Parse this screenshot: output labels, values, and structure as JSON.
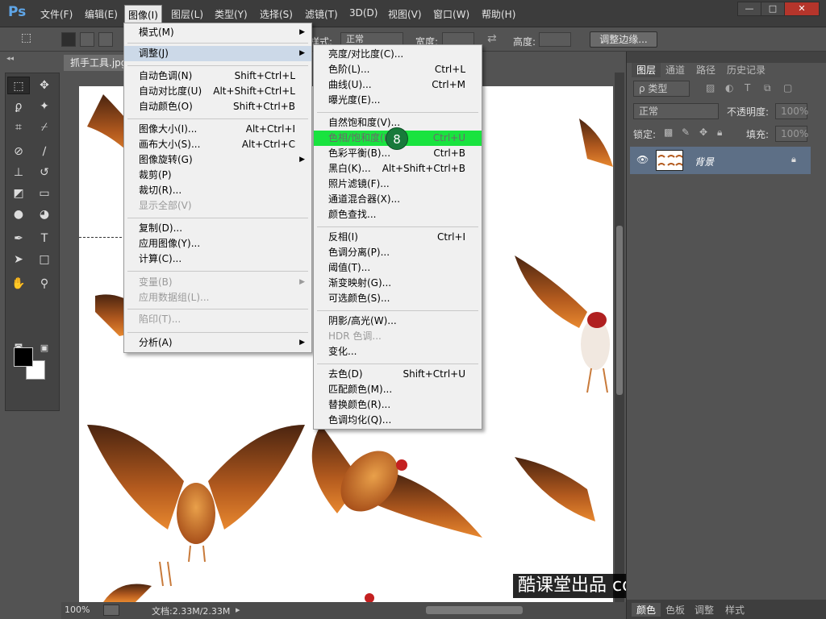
{
  "app": {
    "logo": "Ps"
  },
  "menubar": {
    "items": [
      "文件(F)",
      "编辑(E)",
      "图像(I)",
      "图层(L)",
      "类型(Y)",
      "选择(S)",
      "滤镜(T)",
      "3D(D)",
      "视图(V)",
      "窗口(W)",
      "帮助(H)"
    ],
    "active_index": 2
  },
  "window_buttons": {
    "minimize": "—",
    "maximize": "□",
    "close": "✕"
  },
  "options": {
    "style_label": "样式:",
    "style_value": "正常",
    "width_label": "宽度:",
    "height_label": "高度:",
    "refine_edge": "调整边缘..."
  },
  "document": {
    "tab_title": "抓手工具.jpg"
  },
  "status": {
    "zoom": "100%",
    "doc_info": "文档:2.33M/2.33M"
  },
  "watermark": "酷课堂出品 coolketang.com",
  "image_menu": {
    "items": [
      {
        "label": "模式(M)",
        "shortcut": "",
        "submenu": true
      },
      {
        "label": "调整(J)",
        "shortcut": "",
        "submenu": true,
        "highlight": true
      },
      {
        "label": "自动色调(N)",
        "shortcut": "Shift+Ctrl+L"
      },
      {
        "label": "自动对比度(U)",
        "shortcut": "Alt+Shift+Ctrl+L"
      },
      {
        "label": "自动颜色(O)",
        "shortcut": "Shift+Ctrl+B"
      },
      {
        "label": "图像大小(I)...",
        "shortcut": "Alt+Ctrl+I"
      },
      {
        "label": "画布大小(S)...",
        "shortcut": "Alt+Ctrl+C"
      },
      {
        "label": "图像旋转(G)",
        "shortcut": "",
        "submenu": true
      },
      {
        "label": "裁剪(P)",
        "shortcut": ""
      },
      {
        "label": "裁切(R)...",
        "shortcut": ""
      },
      {
        "label": "显示全部(V)",
        "shortcut": "",
        "disabled": true
      },
      {
        "label": "复制(D)...",
        "shortcut": ""
      },
      {
        "label": "应用图像(Y)...",
        "shortcut": ""
      },
      {
        "label": "计算(C)...",
        "shortcut": ""
      },
      {
        "label": "变量(B)",
        "shortcut": "",
        "submenu": true,
        "disabled": true
      },
      {
        "label": "应用数据组(L)...",
        "shortcut": "",
        "disabled": true
      },
      {
        "label": "陷印(T)...",
        "shortcut": "",
        "disabled": true
      },
      {
        "label": "分析(A)",
        "shortcut": "",
        "submenu": true
      }
    ]
  },
  "adjust_menu": {
    "items": [
      {
        "label": "亮度/对比度(C)...",
        "shortcut": ""
      },
      {
        "label": "色阶(L)...",
        "shortcut": "Ctrl+L"
      },
      {
        "label": "曲线(U)...",
        "shortcut": "Ctrl+M"
      },
      {
        "label": "曝光度(E)...",
        "shortcut": ""
      },
      {
        "label": "自然饱和度(V)...",
        "shortcut": ""
      },
      {
        "label": "色相/饱和度(H)...",
        "shortcut": "Ctrl+U",
        "green": true
      },
      {
        "label": "色彩平衡(B)...",
        "shortcut": "Ctrl+B"
      },
      {
        "label": "黑白(K)...",
        "shortcut": "Alt+Shift+Ctrl+B"
      },
      {
        "label": "照片滤镜(F)...",
        "shortcut": ""
      },
      {
        "label": "通道混合器(X)...",
        "shortcut": ""
      },
      {
        "label": "颜色查找...",
        "shortcut": ""
      },
      {
        "label": "反相(I)",
        "shortcut": "Ctrl+I"
      },
      {
        "label": "色调分离(P)...",
        "shortcut": ""
      },
      {
        "label": "阈值(T)...",
        "shortcut": ""
      },
      {
        "label": "渐变映射(G)...",
        "shortcut": ""
      },
      {
        "label": "可选颜色(S)...",
        "shortcut": ""
      },
      {
        "label": "阴影/高光(W)...",
        "shortcut": ""
      },
      {
        "label": "HDR 色调...",
        "shortcut": "",
        "disabled": true
      },
      {
        "label": "变化...",
        "shortcut": ""
      },
      {
        "label": "去色(D)",
        "shortcut": "Shift+Ctrl+U"
      },
      {
        "label": "匹配颜色(M)...",
        "shortcut": ""
      },
      {
        "label": "替换颜色(R)...",
        "shortcut": ""
      },
      {
        "label": "色调均化(Q)...",
        "shortcut": ""
      }
    ]
  },
  "step_badge": "8",
  "layers_panel": {
    "tabs": [
      "图层",
      "通道",
      "路径",
      "历史记录"
    ],
    "filter_kind": "ρ 类型",
    "blend_mode": "正常",
    "opacity_label": "不透明度:",
    "opacity_value": "100%",
    "lock_label": "锁定:",
    "fill_label": "填充:",
    "fill_value": "100%",
    "layer_name": "背景"
  },
  "bottom_panel_tabs": [
    "颜色",
    "色板",
    "调整",
    "样式"
  ],
  "colors": {
    "highlight_green": "#19e33f",
    "badge": "#187a3b",
    "layer_selected": "#5d6f86"
  }
}
